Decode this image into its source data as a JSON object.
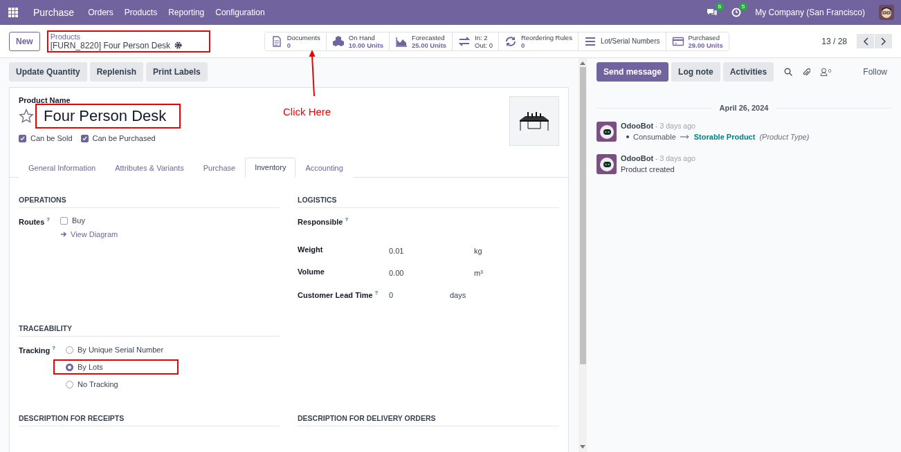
{
  "navbar": {
    "app": "Purchase",
    "menus": [
      "Orders",
      "Products",
      "Reporting",
      "Configuration"
    ],
    "messages_count": "6",
    "activities_count": "5",
    "company": "My Company (San Francisco)"
  },
  "control_panel": {
    "new_button": "New",
    "breadcrumb": {
      "parent": "Products",
      "current": "[FURN_8220] Four Person Desk",
      "highlighted": true
    },
    "smart_buttons": [
      {
        "kind": "documents",
        "label": "Documents",
        "value": "0"
      },
      {
        "kind": "on_hand",
        "label": "On Hand",
        "value": "10.00 Units"
      },
      {
        "kind": "forecasted",
        "label": "Forecasted",
        "value": "25.00 Units"
      },
      {
        "kind": "in_out",
        "label": "In: 2",
        "value": "Out: 0"
      },
      {
        "kind": "reordering",
        "label": "Reordering Rules",
        "value": "0"
      },
      {
        "kind": "lots",
        "label": "Lot/Serial Numbers"
      },
      {
        "kind": "purchased",
        "label": "Purchased",
        "value": "29.00 Units"
      }
    ],
    "pager": "13 / 28"
  },
  "actions": [
    "Update Quantity",
    "Replenish",
    "Print Labels"
  ],
  "annotation": {
    "text": "Click Here"
  },
  "form": {
    "name_label": "Product Name",
    "name": "Four Person Desk",
    "name_highlighted": true,
    "favorite": false,
    "checkboxes": [
      {
        "label": "Can be Sold",
        "checked": true
      },
      {
        "label": "Can be Purchased",
        "checked": true
      }
    ],
    "tabs": [
      {
        "label": "General Information",
        "selected": false
      },
      {
        "label": "Attributes & Variants",
        "selected": false
      },
      {
        "label": "Purchase",
        "selected": false
      },
      {
        "label": "Inventory",
        "selected": true
      },
      {
        "label": "Accounting",
        "selected": false
      }
    ],
    "operations": {
      "title": "OPERATIONS",
      "routes_label": "Routes",
      "help": "?",
      "routes": [
        {
          "label": "Buy",
          "checked": false
        }
      ],
      "link": "View Diagram"
    },
    "logistics": {
      "title": "LOGISTICS",
      "fields": [
        {
          "label": "Responsible",
          "help": "?"
        },
        {
          "label": "Weight",
          "value": "0.01",
          "unit": "kg"
        },
        {
          "label": "Volume",
          "value": "0.00",
          "unit": "m³"
        },
        {
          "label": "Customer Lead Time",
          "help": "?",
          "value": "0",
          "unit": "days"
        }
      ]
    },
    "traceability": {
      "title": "TRACEABILITY",
      "label": "Tracking",
      "help": "?",
      "options": [
        {
          "label": "By Unique Serial Number",
          "selected": false,
          "highlighted": false
        },
        {
          "label": "By Lots",
          "selected": true,
          "highlighted": true
        },
        {
          "label": "No Tracking",
          "selected": false,
          "highlighted": false
        }
      ]
    },
    "descriptions": [
      "DESCRIPTION FOR RECEIPTS",
      "DESCRIPTION FOR DELIVERY ORDERS"
    ]
  },
  "chatter": {
    "buttons": [
      {
        "label": "Send message",
        "selected": true
      },
      {
        "label": "Log note",
        "selected": false
      },
      {
        "label": "Activities",
        "selected": false
      }
    ],
    "followers_count": "0",
    "follow": "Follow",
    "date": "April 26, 2024",
    "messages": [
      {
        "author": "OdooBot",
        "time": "- 3 days ago",
        "kind": "change",
        "old": "Consumable",
        "new": "Storable Product",
        "field": "(Product Type)"
      },
      {
        "author": "OdooBot",
        "time": "- 3 days ago",
        "kind": "text",
        "text": "Product created"
      }
    ]
  }
}
